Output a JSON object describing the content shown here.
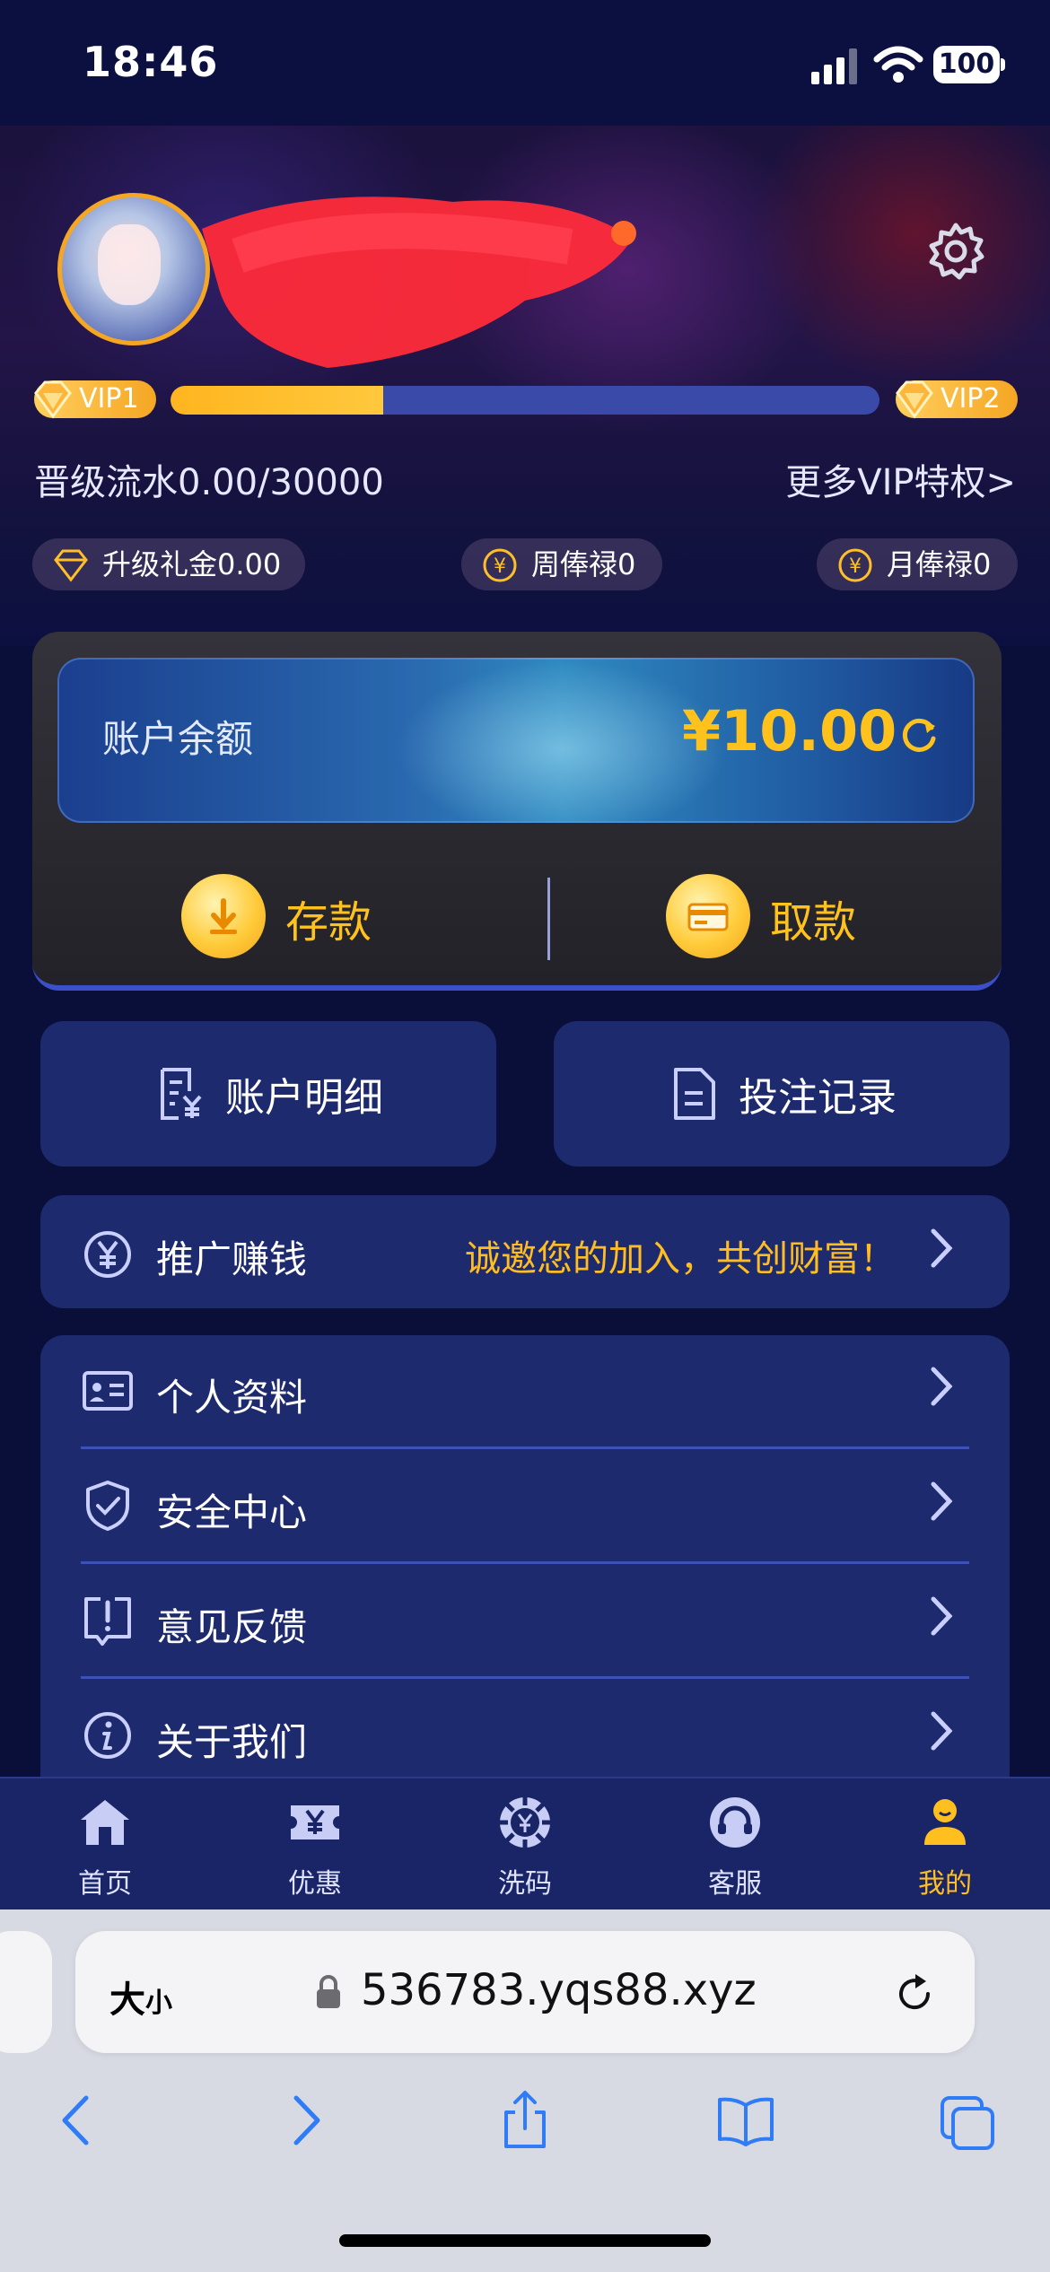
{
  "status_bar": {
    "time": "18:46",
    "battery": "100"
  },
  "profile": {
    "vip_current": "VIP1",
    "vip_next": "VIP2",
    "vip_progress_fraction": 0.3,
    "upgrade_text": "晋级流水0.00/30000",
    "more_vip": "更多VIP特权>"
  },
  "rewards": [
    {
      "label": "升级礼金0.00",
      "icon": "diamond-icon"
    },
    {
      "label": "周俸禄0",
      "icon": "yen-coin-icon"
    },
    {
      "label": "月俸禄0",
      "icon": "yen-coin-icon"
    }
  ],
  "wallet": {
    "balance_label": "账户余额",
    "balance_value": "¥10.00",
    "deposit_label": "存款",
    "withdraw_label": "取款"
  },
  "shortcuts": {
    "account_detail": "账户明细",
    "bet_record": "投注记录"
  },
  "promo": {
    "label": "推广赚钱",
    "slogan": "诚邀您的加入，共创财富！"
  },
  "menu": [
    {
      "label": "个人资料",
      "icon": "id-card-icon"
    },
    {
      "label": "安全中心",
      "icon": "shield-check-icon"
    },
    {
      "label": "意见反馈",
      "icon": "feedback-icon"
    },
    {
      "label": "关于我们",
      "icon": "info-icon"
    }
  ],
  "tabs": [
    {
      "label": "首页",
      "icon": "home-icon",
      "active": false
    },
    {
      "label": "优惠",
      "icon": "ticket-icon",
      "active": false
    },
    {
      "label": "洗码",
      "icon": "chip-icon",
      "active": false
    },
    {
      "label": "客服",
      "icon": "headset-icon",
      "active": false
    },
    {
      "label": "我的",
      "icon": "user-icon",
      "active": true
    }
  ],
  "browser": {
    "text_size_large": "大",
    "text_size_small": "小",
    "url": "536783.yqs88.xyz"
  },
  "colors": {
    "accent_gold": "#ffc21d",
    "card_blue": "#1d2a6e",
    "background": "#0a0f3a"
  }
}
